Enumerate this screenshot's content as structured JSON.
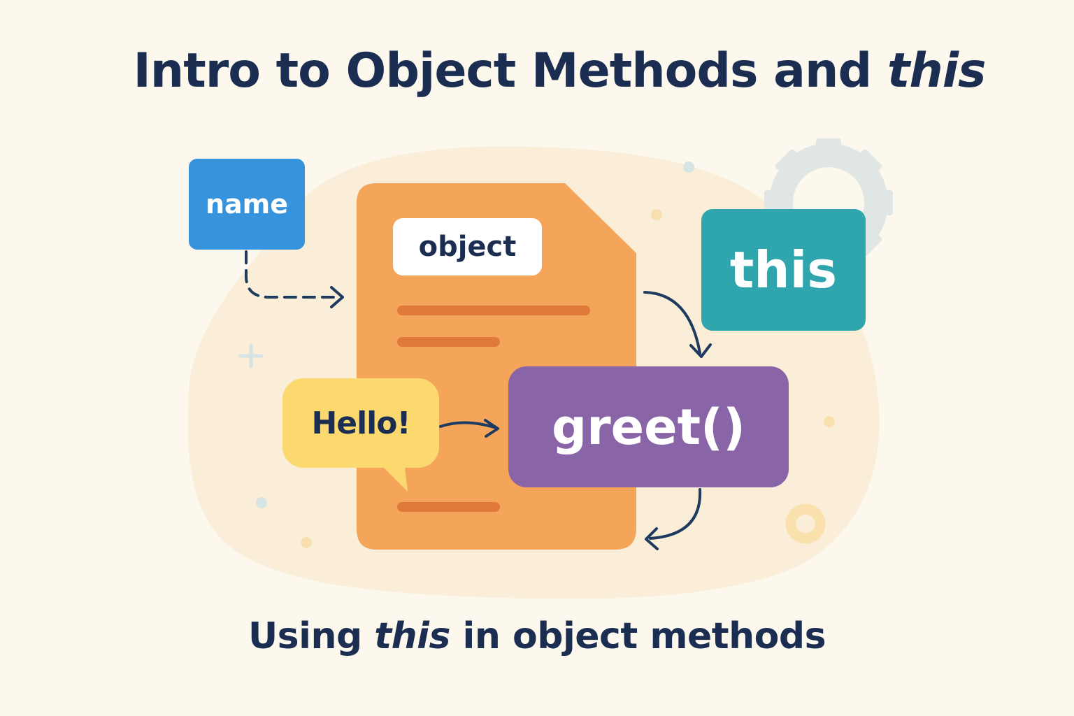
{
  "title": {
    "prefix": "Intro to Object Methods and ",
    "emphasis": "this"
  },
  "subtitle": {
    "prefix": "Using ",
    "emphasis": "this",
    "suffix": " in object methods"
  },
  "labels": {
    "name": "name",
    "object": "object",
    "this": "this",
    "greet": "greet()",
    "hello": "Hello!"
  },
  "icons": [
    "gear-icon",
    "plus-icon",
    "ring-icon",
    "dot-icon",
    "speech-bubble-icon",
    "arrow-icon"
  ],
  "colors": {
    "background": "#fcf8ee",
    "text": "#1b2e52",
    "name_box": "#3794dc",
    "object_card": "#f5a55a",
    "object_lines": "#df7a3a",
    "this_box": "#2fa6ad",
    "greet_box": "#8965a7",
    "speech_bubble": "#fbd96e",
    "arrows": "#1e3a5f"
  }
}
